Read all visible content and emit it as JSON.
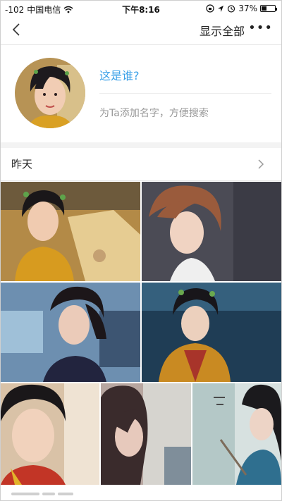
{
  "status_bar": {
    "signal": "-102",
    "carrier": "中国电信",
    "time": "下午8:16",
    "battery": "37%",
    "battery_level": 0.37
  },
  "nav": {
    "show_all": "显示全部",
    "more": "•••"
  },
  "profile": {
    "question": "这是谁?",
    "hint": "为Ta添加名字，方便搜索"
  },
  "section": {
    "label": "昨天"
  },
  "icons": [
    "back-arrow-icon",
    "more-icon",
    "chevron-right-icon",
    "wifi-icon",
    "location-icon",
    "alarm-icon",
    "orientation-lock-icon"
  ],
  "photos_count": 7
}
